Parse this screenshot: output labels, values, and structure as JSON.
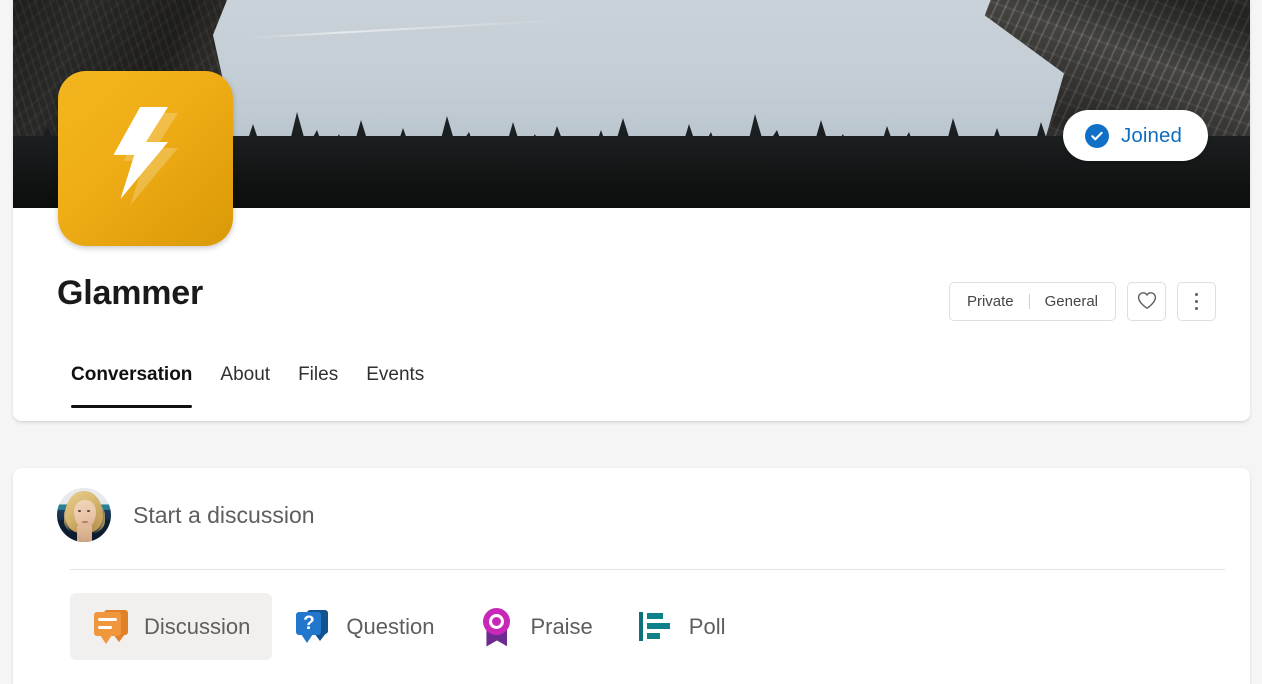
{
  "community": {
    "name": "Glammer",
    "logo_icon": "lightning-bolt-icon",
    "logo_color": "#efad16",
    "banner_alt": "dark forest and granite cliffs landscape"
  },
  "header": {
    "joined_button": {
      "label": "Joined",
      "icon": "check-circle-icon",
      "color": "#106ebe"
    },
    "privacy_chip": "Private",
    "classification_chip": "General",
    "favorite_icon": "heart-icon",
    "more_options_icon": "more-vertical-icon"
  },
  "tabs": [
    {
      "label": "Conversation",
      "active": true
    },
    {
      "label": "About",
      "active": false
    },
    {
      "label": "Files",
      "active": false
    },
    {
      "label": "Events",
      "active": false
    }
  ],
  "composer": {
    "avatar_icon": "user-avatar",
    "placeholder": "Start a discussion",
    "post_types": [
      {
        "label": "Discussion",
        "icon": "discussion-icon",
        "color": "#f0963c",
        "selected": true
      },
      {
        "label": "Question",
        "icon": "question-icon",
        "color": "#2277cc",
        "selected": false
      },
      {
        "label": "Praise",
        "icon": "praise-icon",
        "color": "#c828b8",
        "selected": false
      },
      {
        "label": "Poll",
        "icon": "poll-icon",
        "color": "#0e8089",
        "selected": false
      }
    ]
  }
}
